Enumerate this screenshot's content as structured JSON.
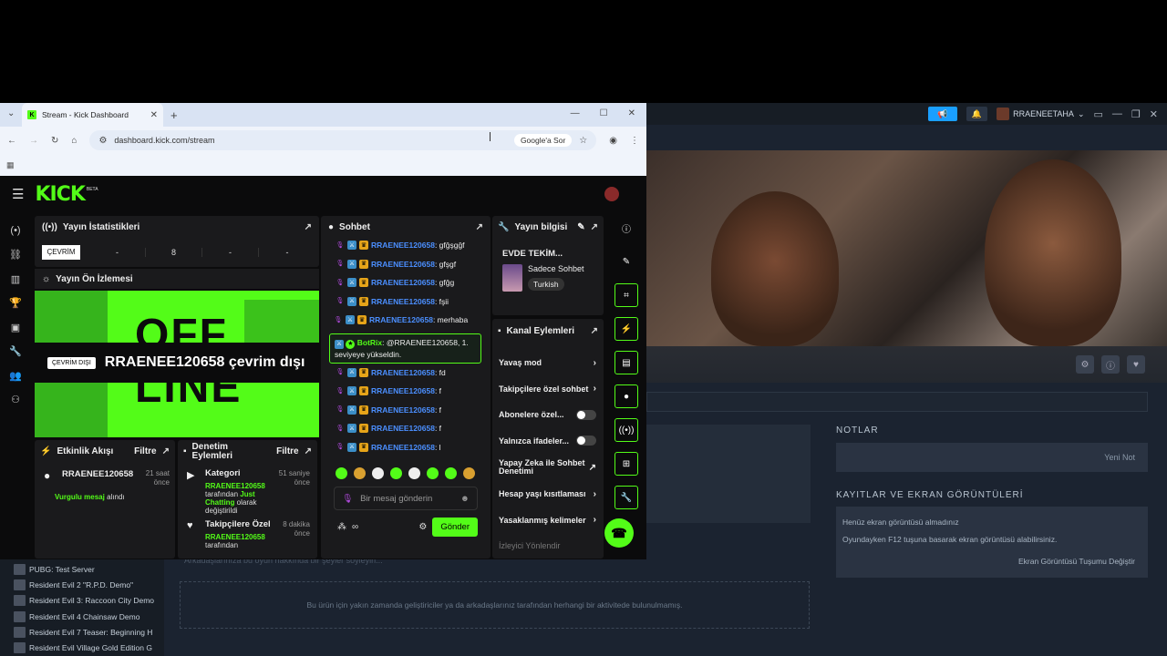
{
  "steam": {
    "user": "RRAENEETAHA",
    "notes_label": "NOTLAR",
    "new_note": "Yeni Not",
    "shots_label": "KAYITLAR VE EKRAN GÖRÜNTÜLERİ",
    "shots_line1": "Henüz ekran görüntüsü almadınız",
    "shots_line2": "Oyundayken F12 tuşuna basarak ekran görüntüsü alabilirsiniz.",
    "shots_change": "Ekran Görüntüsü Tuşumu Değiştir",
    "say_text": "Arkadaşlarınıza bu oyun hakkında bir şeyler söyleyin...",
    "activity_text": "Bu ürün için yakın zamanda geliştiriciler ya da arkadaşlarınız tarafından herhangi bir aktivitede bulunulmamış.",
    "games": [
      {
        "name": "PUBG: Test Server"
      },
      {
        "name": "Resident Evil 2 \"R.P.D. Demo\""
      },
      {
        "name": "Resident Evil 3: Raccoon City Demo"
      },
      {
        "name": "Resident Evil 4 Chainsaw Demo"
      },
      {
        "name": "Resident Evil 7 Teaser: Beginning H"
      },
      {
        "name": "Resident Evil Village Gold Edition G"
      }
    ]
  },
  "browser": {
    "tab_title": "Stream - Kick Dashboard",
    "url": "dashboard.kick.com/stream",
    "google_ask": "Google'a Sor"
  },
  "kick": {
    "logo": "KICK",
    "beta": "BETA",
    "stats": {
      "title": "Yayın İstatistikleri",
      "status": "ÇEVRİM",
      "values": [
        "-",
        "8",
        "-",
        "-"
      ]
    },
    "preview": {
      "title": "Yayın Ön İzlemesi",
      "bg_text": "OFF\nLINE",
      "badge": "ÇEVRİM DIŞI",
      "text": "RRAENEE120658 çevrim dışı"
    },
    "events": {
      "title": "Etkinlik Akışı",
      "filter": "Filtre",
      "item_name": "RRAENEE120658",
      "item_time": "21 saat önce",
      "item_sub_hl": "Vurgulu mesaj",
      "item_sub": "alındı"
    },
    "mod": {
      "title": "Denetim Eylemleri",
      "filter": "Filtre",
      "items": [
        {
          "title": "Kategori",
          "time": "51 saniye önce",
          "user": "RRAENEE120658",
          "mid": "tarafından",
          "cat": "Just Chatting",
          "tail": "olarak değiştirildi"
        },
        {
          "title": "Takipçilere Özel",
          "time": "8 dakika önce",
          "user": "RRAENEE120658",
          "mid": "tarafından",
          "cat": "",
          "tail": ""
        }
      ]
    },
    "chat": {
      "title": "Sohbet",
      "messages": [
        {
          "user": "RRAENEE120658",
          "text": ": gfğşgğf"
        },
        {
          "user": "RRAENEE120658",
          "text": ": gfşgf"
        },
        {
          "user": "RRAENEE120658",
          "text": ": gfğg"
        },
        {
          "user": "RRAENEE120658",
          "text": ": fşii"
        },
        {
          "user": "RRAENEE120658",
          "text": ": merhaba"
        }
      ],
      "bot_name": "BotRix",
      "bot_text": ": @RRAENEE120658, 1. seviyeye yükseldin.",
      "messages2": [
        {
          "user": "RRAENEE120658",
          "text": ": fd"
        },
        {
          "user": "RRAENEE120658",
          "text": ": f"
        },
        {
          "user": "RRAENEE120658",
          "text": ": f"
        },
        {
          "user": "RRAENEE120658",
          "text": ": f"
        },
        {
          "user": "RRAENEE120658",
          "text": ": l"
        }
      ],
      "placeholder": "Bir mesaj gönderin",
      "send": "Gönder"
    },
    "info": {
      "title": "Yayın bilgisi",
      "stream_title": "EVDE TEKİM...",
      "category": "Sadece Sohbet",
      "tag": "Turkish"
    },
    "actions": {
      "title": "Kanal Eylemleri",
      "items": [
        {
          "label": "Yavaş mod",
          "kind": "chev"
        },
        {
          "label": "Takipçilere özel sohbet",
          "kind": "chev"
        },
        {
          "label": "Abonelere özel...",
          "kind": "toggle"
        },
        {
          "label": "Yalnızca ifadeler...",
          "kind": "toggle"
        },
        {
          "label": "Yapay Zeka ile Sohbet Denetimi",
          "kind": "ext"
        },
        {
          "label": "Hesap yaşı kısıtlaması",
          "kind": "chev"
        },
        {
          "label": "Yasaklanmış kelimeler",
          "kind": "chev"
        },
        {
          "label": "İzleyici Yönlendir",
          "kind": "dim"
        }
      ]
    }
  }
}
